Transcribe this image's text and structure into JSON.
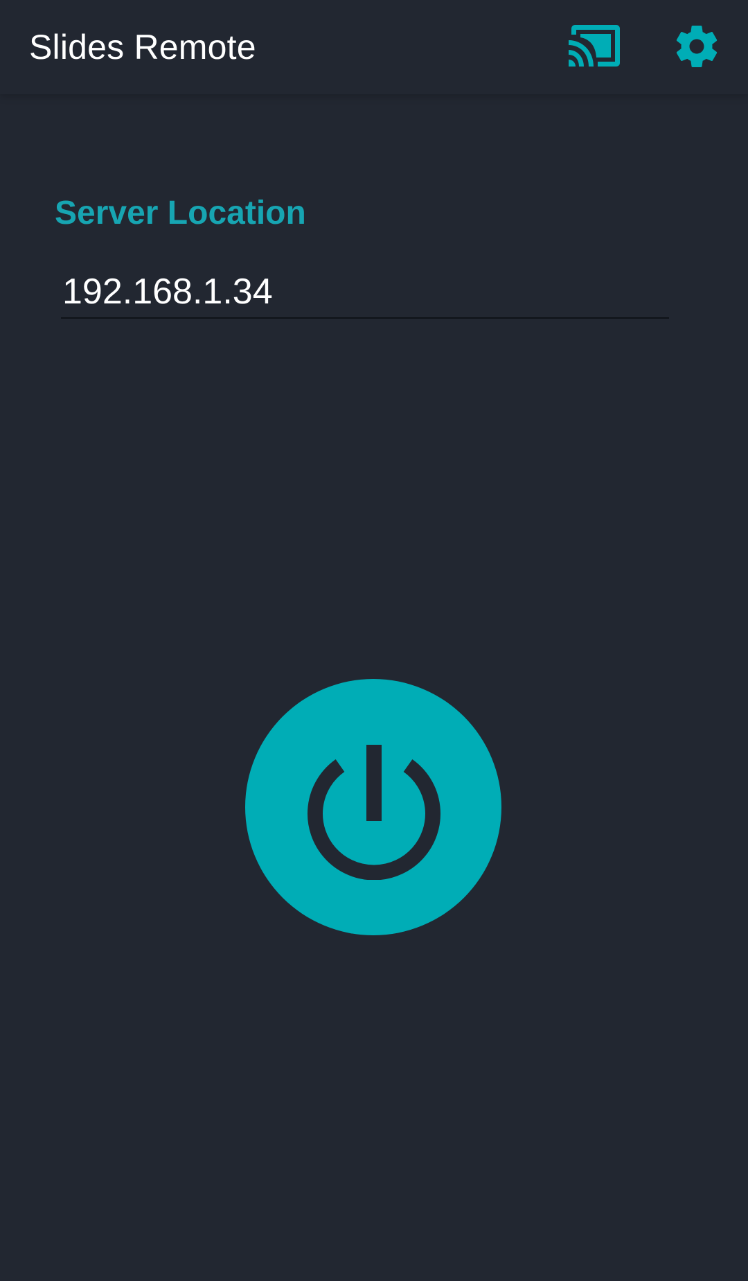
{
  "toolbar": {
    "title": "Slides Remote",
    "cast_icon": "cast-icon",
    "settings_icon": "gear-icon"
  },
  "server": {
    "label": "Server Location",
    "value": "192.168.1.34"
  },
  "power": {
    "icon": "power-icon"
  },
  "colors": {
    "background": "#222731",
    "accent": "#00adb6",
    "label_accent": "#17a5b2",
    "text": "#ffffff"
  }
}
